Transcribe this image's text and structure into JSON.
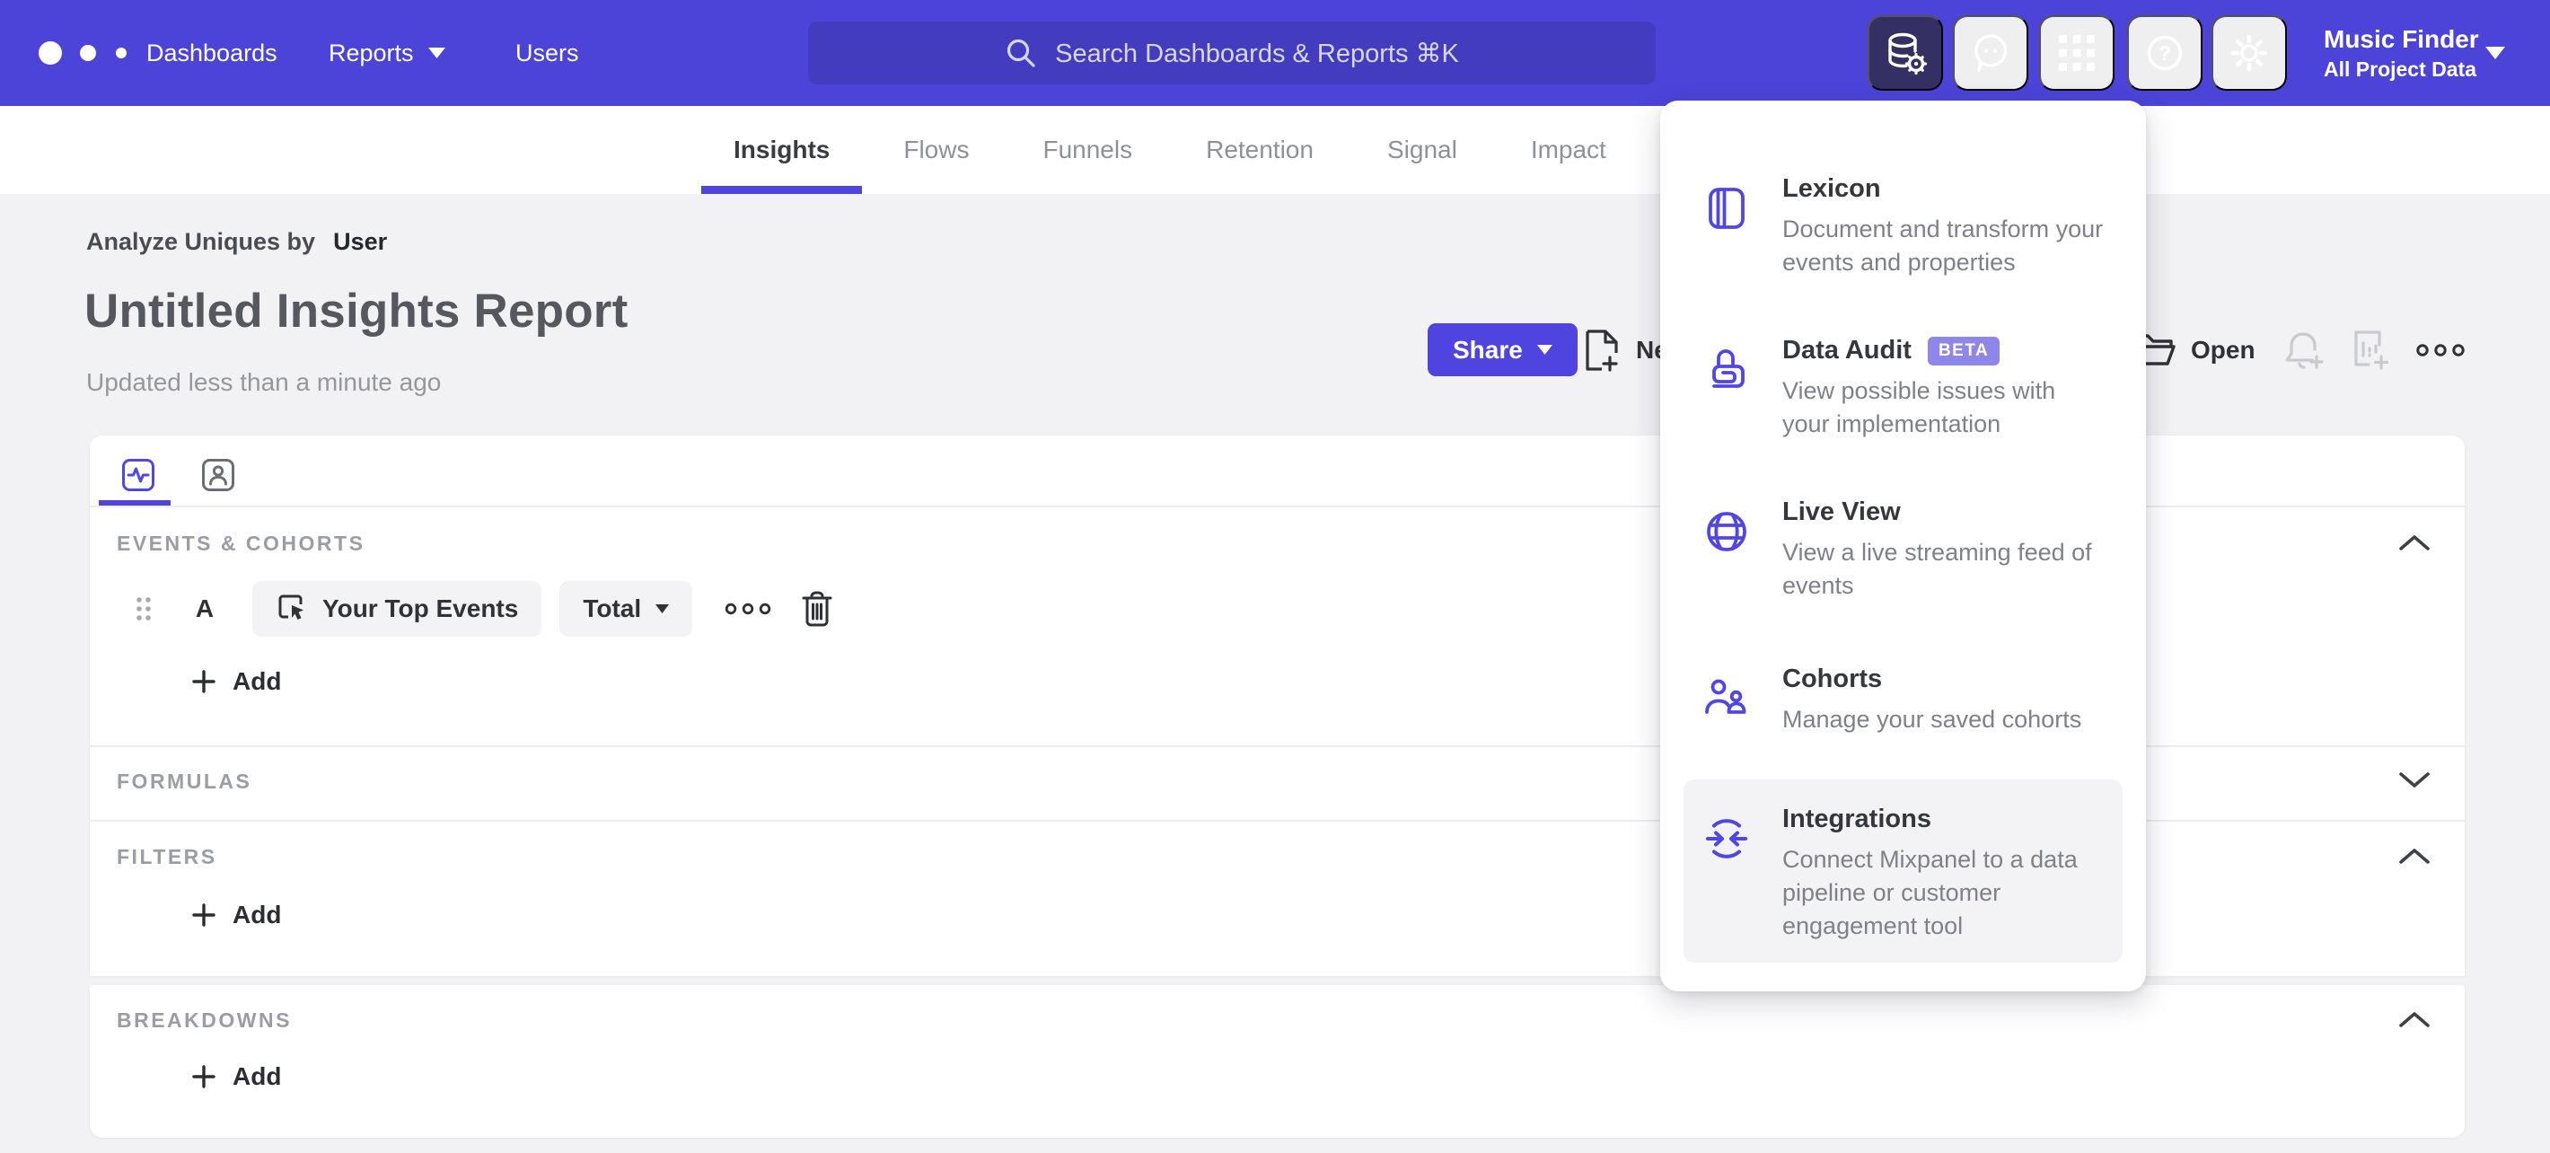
{
  "colors": {
    "nav": "#4C44D9",
    "accent": "#4F44E0",
    "search_bg": "#443CBE",
    "active_icon_bg": "#353063",
    "badge_bg": "#8F86E9",
    "page_bg": "#F2F2F4"
  },
  "topnav": {
    "items": [
      "Dashboards",
      "Reports",
      "Users"
    ],
    "search_placeholder": "Search Dashboards & Reports ⌘K",
    "project_name": "Music Finder",
    "project_scope": "All Project Data"
  },
  "tabs": [
    {
      "label": "Insights"
    },
    {
      "label": "Flows"
    },
    {
      "label": "Funnels"
    },
    {
      "label": "Retention"
    },
    {
      "label": "Signal"
    },
    {
      "label": "Impact"
    }
  ],
  "header": {
    "analyze_label": "Analyze Uniques by",
    "analyze_value": "User",
    "title": "Untitled Insights Report",
    "updated": "Updated less than a minute ago",
    "share": "Share",
    "new": "New",
    "open": "Open"
  },
  "builder": {
    "events_label": "EVENTS & COHORTS",
    "formulas_label": "FORMULAS",
    "filters_label": "FILTERS",
    "breakdowns_label": "BREAKDOWNS",
    "row_letter": "A",
    "event_name": "Your Top Events",
    "metric": "Total",
    "add": "Add"
  },
  "menu": {
    "items": [
      {
        "title": "Lexicon",
        "desc": "Document and transform your events and properties"
      },
      {
        "title": "Data Audit",
        "badge": "BETA",
        "desc": "View possible issues with your implementation"
      },
      {
        "title": "Live View",
        "desc": "View a live streaming feed of events"
      },
      {
        "title": "Cohorts",
        "desc": "Manage your saved cohorts"
      },
      {
        "title": "Integrations",
        "desc": "Connect Mixpanel to a data pipeline or customer engagement tool"
      }
    ]
  }
}
